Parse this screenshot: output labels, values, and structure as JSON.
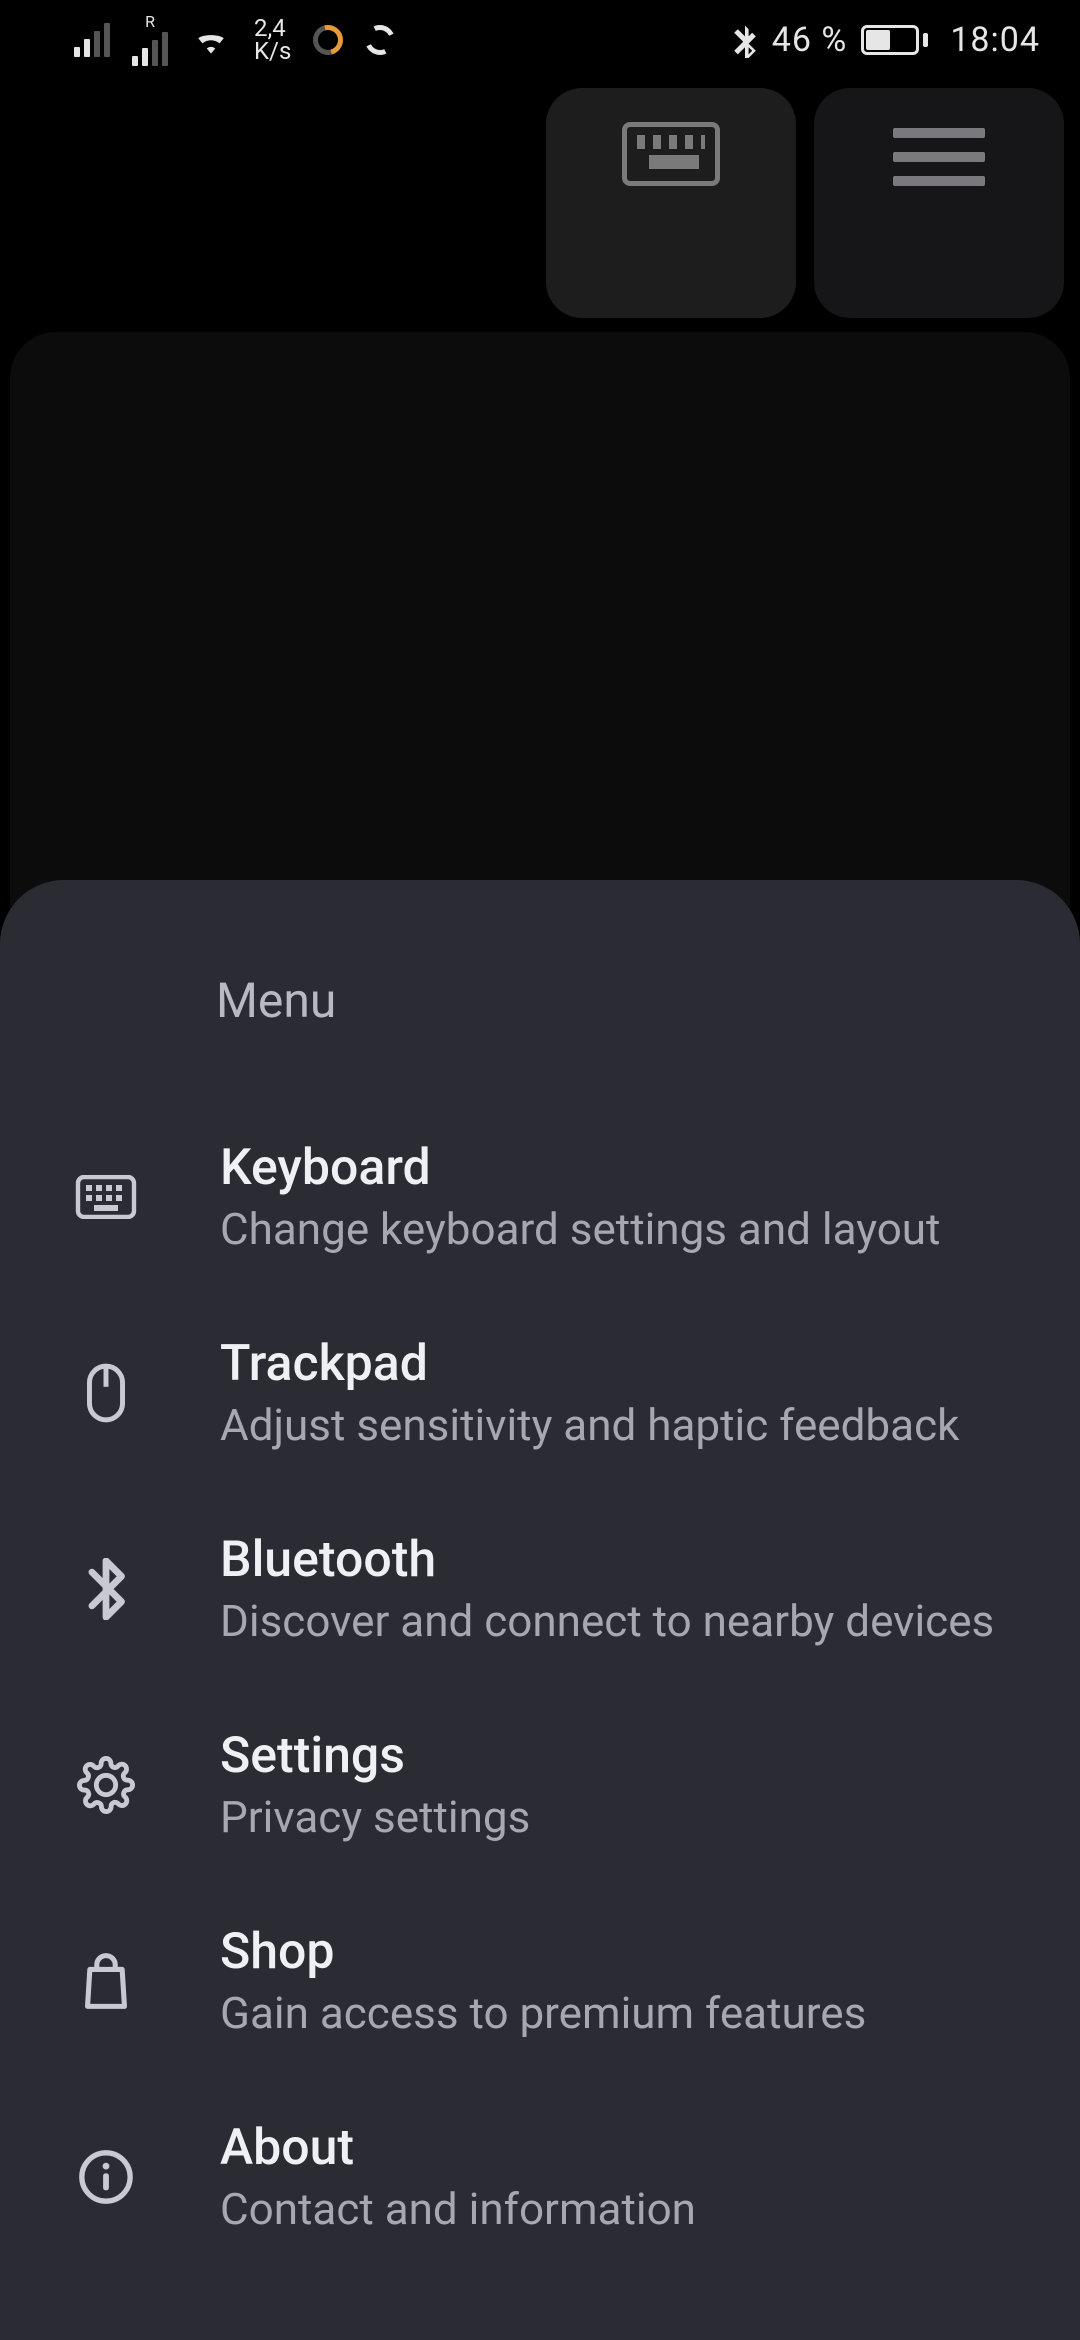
{
  "statusbar": {
    "net_rate_top": "2,4",
    "net_rate_bottom": "K/s",
    "roaming_label": "R",
    "bt_batt": "46 %",
    "time": "18:04"
  },
  "sheet": {
    "title": "Menu",
    "items": [
      {
        "icon": "keyboard-icon",
        "title": "Keyboard",
        "sub": "Change keyboard settings and layout"
      },
      {
        "icon": "mouse-icon",
        "title": "Trackpad",
        "sub": "Adjust sensitivity and haptic feedback"
      },
      {
        "icon": "bluetooth-icon",
        "title": "Bluetooth",
        "sub": "Discover and connect to nearby devices"
      },
      {
        "icon": "gear-icon",
        "title": "Settings",
        "sub": "Privacy settings"
      },
      {
        "icon": "bag-icon",
        "title": "Shop",
        "sub": "Gain access to premium features"
      },
      {
        "icon": "info-icon",
        "title": "About",
        "sub": "Contact and information"
      }
    ]
  }
}
